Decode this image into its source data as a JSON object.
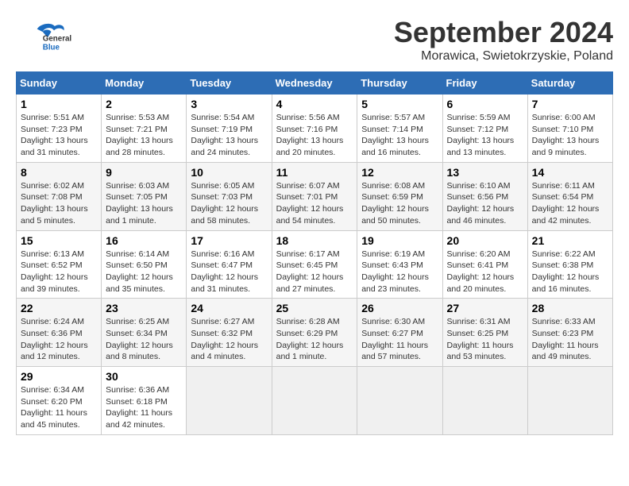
{
  "header": {
    "logo_general": "General",
    "logo_blue": "Blue",
    "month_year": "September 2024",
    "location": "Morawica, Swietokrzyskie, Poland"
  },
  "weekdays": [
    "Sunday",
    "Monday",
    "Tuesday",
    "Wednesday",
    "Thursday",
    "Friday",
    "Saturday"
  ],
  "weeks": [
    [
      {
        "day": "1",
        "info": "Sunrise: 5:51 AM\nSunset: 7:23 PM\nDaylight: 13 hours\nand 31 minutes."
      },
      {
        "day": "2",
        "info": "Sunrise: 5:53 AM\nSunset: 7:21 PM\nDaylight: 13 hours\nand 28 minutes."
      },
      {
        "day": "3",
        "info": "Sunrise: 5:54 AM\nSunset: 7:19 PM\nDaylight: 13 hours\nand 24 minutes."
      },
      {
        "day": "4",
        "info": "Sunrise: 5:56 AM\nSunset: 7:16 PM\nDaylight: 13 hours\nand 20 minutes."
      },
      {
        "day": "5",
        "info": "Sunrise: 5:57 AM\nSunset: 7:14 PM\nDaylight: 13 hours\nand 16 minutes."
      },
      {
        "day": "6",
        "info": "Sunrise: 5:59 AM\nSunset: 7:12 PM\nDaylight: 13 hours\nand 13 minutes."
      },
      {
        "day": "7",
        "info": "Sunrise: 6:00 AM\nSunset: 7:10 PM\nDaylight: 13 hours\nand 9 minutes."
      }
    ],
    [
      {
        "day": "8",
        "info": "Sunrise: 6:02 AM\nSunset: 7:08 PM\nDaylight: 13 hours\nand 5 minutes."
      },
      {
        "day": "9",
        "info": "Sunrise: 6:03 AM\nSunset: 7:05 PM\nDaylight: 13 hours\nand 1 minute."
      },
      {
        "day": "10",
        "info": "Sunrise: 6:05 AM\nSunset: 7:03 PM\nDaylight: 12 hours\nand 58 minutes."
      },
      {
        "day": "11",
        "info": "Sunrise: 6:07 AM\nSunset: 7:01 PM\nDaylight: 12 hours\nand 54 minutes."
      },
      {
        "day": "12",
        "info": "Sunrise: 6:08 AM\nSunset: 6:59 PM\nDaylight: 12 hours\nand 50 minutes."
      },
      {
        "day": "13",
        "info": "Sunrise: 6:10 AM\nSunset: 6:56 PM\nDaylight: 12 hours\nand 46 minutes."
      },
      {
        "day": "14",
        "info": "Sunrise: 6:11 AM\nSunset: 6:54 PM\nDaylight: 12 hours\nand 42 minutes."
      }
    ],
    [
      {
        "day": "15",
        "info": "Sunrise: 6:13 AM\nSunset: 6:52 PM\nDaylight: 12 hours\nand 39 minutes."
      },
      {
        "day": "16",
        "info": "Sunrise: 6:14 AM\nSunset: 6:50 PM\nDaylight: 12 hours\nand 35 minutes."
      },
      {
        "day": "17",
        "info": "Sunrise: 6:16 AM\nSunset: 6:47 PM\nDaylight: 12 hours\nand 31 minutes."
      },
      {
        "day": "18",
        "info": "Sunrise: 6:17 AM\nSunset: 6:45 PM\nDaylight: 12 hours\nand 27 minutes."
      },
      {
        "day": "19",
        "info": "Sunrise: 6:19 AM\nSunset: 6:43 PM\nDaylight: 12 hours\nand 23 minutes."
      },
      {
        "day": "20",
        "info": "Sunrise: 6:20 AM\nSunset: 6:41 PM\nDaylight: 12 hours\nand 20 minutes."
      },
      {
        "day": "21",
        "info": "Sunrise: 6:22 AM\nSunset: 6:38 PM\nDaylight: 12 hours\nand 16 minutes."
      }
    ],
    [
      {
        "day": "22",
        "info": "Sunrise: 6:24 AM\nSunset: 6:36 PM\nDaylight: 12 hours\nand 12 minutes."
      },
      {
        "day": "23",
        "info": "Sunrise: 6:25 AM\nSunset: 6:34 PM\nDaylight: 12 hours\nand 8 minutes."
      },
      {
        "day": "24",
        "info": "Sunrise: 6:27 AM\nSunset: 6:32 PM\nDaylight: 12 hours\nand 4 minutes."
      },
      {
        "day": "25",
        "info": "Sunrise: 6:28 AM\nSunset: 6:29 PM\nDaylight: 12 hours\nand 1 minute."
      },
      {
        "day": "26",
        "info": "Sunrise: 6:30 AM\nSunset: 6:27 PM\nDaylight: 11 hours\nand 57 minutes."
      },
      {
        "day": "27",
        "info": "Sunrise: 6:31 AM\nSunset: 6:25 PM\nDaylight: 11 hours\nand 53 minutes."
      },
      {
        "day": "28",
        "info": "Sunrise: 6:33 AM\nSunset: 6:23 PM\nDaylight: 11 hours\nand 49 minutes."
      }
    ],
    [
      {
        "day": "29",
        "info": "Sunrise: 6:34 AM\nSunset: 6:20 PM\nDaylight: 11 hours\nand 45 minutes."
      },
      {
        "day": "30",
        "info": "Sunrise: 6:36 AM\nSunset: 6:18 PM\nDaylight: 11 hours\nand 42 minutes."
      },
      {
        "day": "",
        "info": ""
      },
      {
        "day": "",
        "info": ""
      },
      {
        "day": "",
        "info": ""
      },
      {
        "day": "",
        "info": ""
      },
      {
        "day": "",
        "info": ""
      }
    ]
  ]
}
